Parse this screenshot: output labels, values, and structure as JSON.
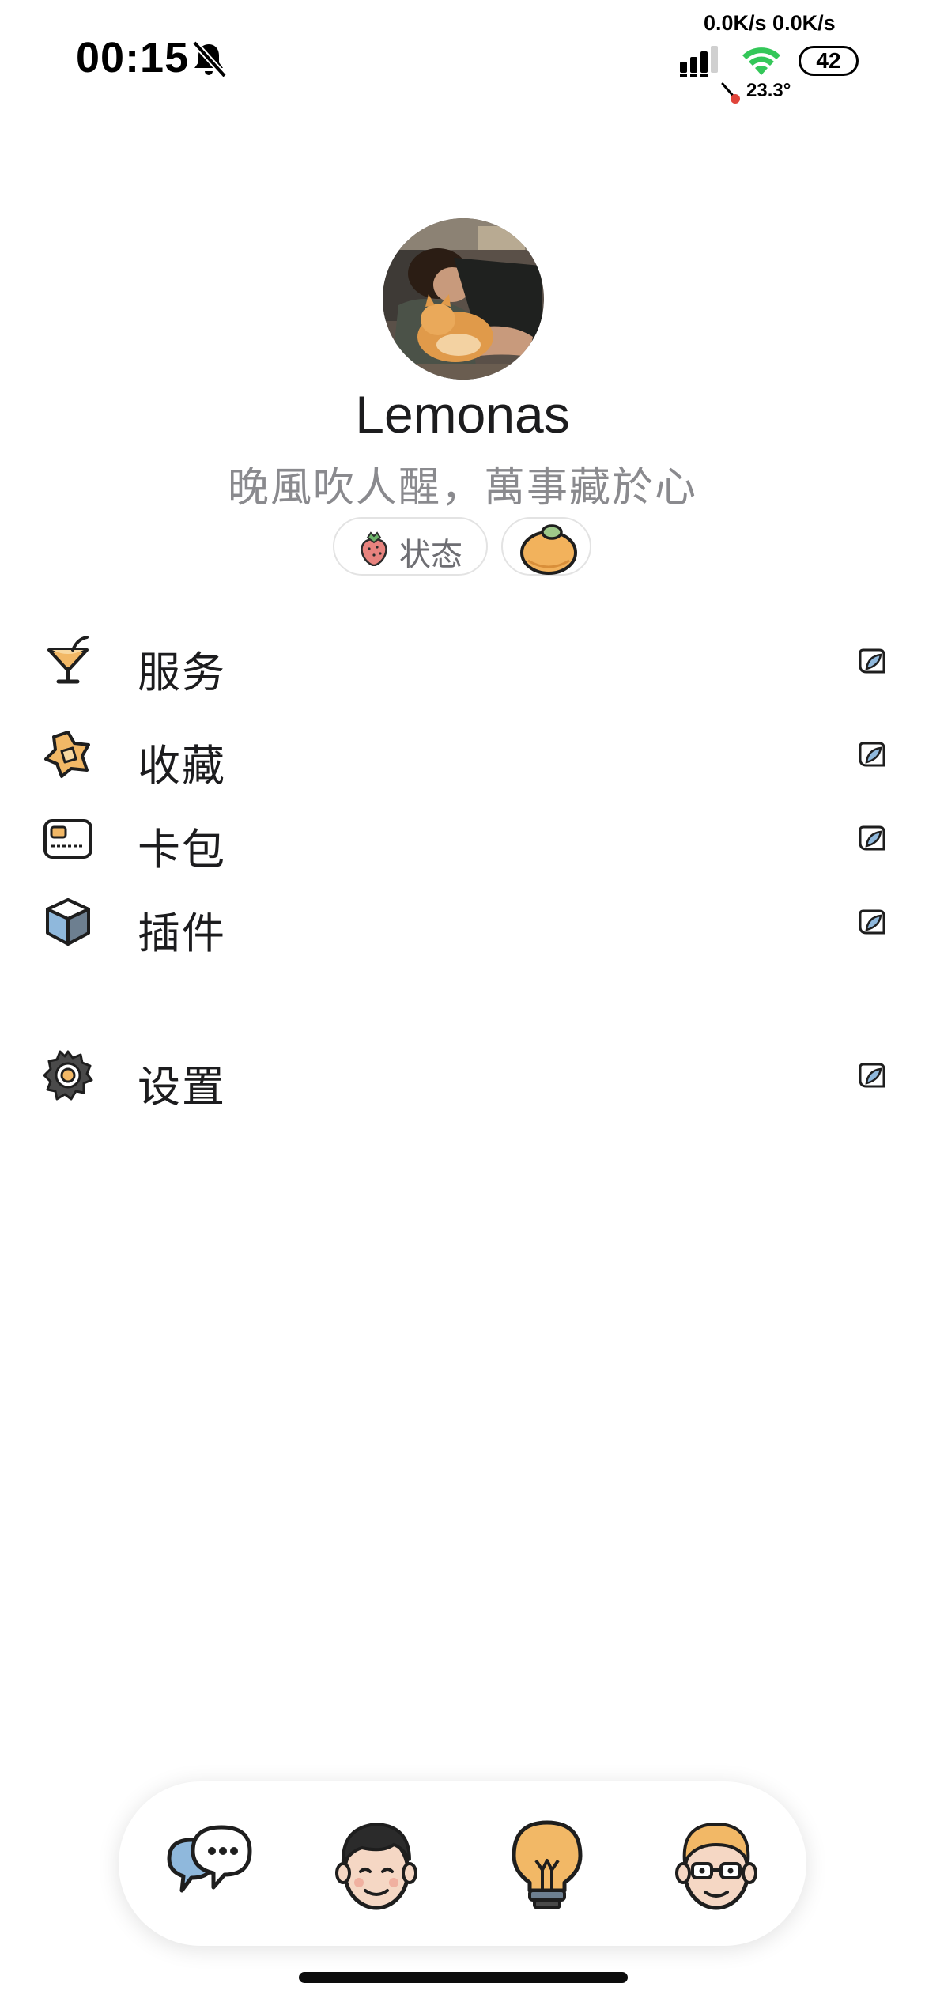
{
  "status_bar": {
    "time": "00:15",
    "net_speed": "0.0K/s 0.0K/s",
    "battery": "42",
    "temperature": "23.3°",
    "icons": [
      "bell-slash-icon",
      "signal-icon",
      "wifi-icon",
      "thermometer-icon"
    ]
  },
  "profile": {
    "name": "Lemonas",
    "bio": "晚風吹人醒，萬事藏於心",
    "status_chip_label": "状态",
    "status_chip_icon": "strawberry-icon",
    "mood_chip_icon": "orange-icon"
  },
  "menu": {
    "items": [
      {
        "label": "服务",
        "icon": "cocktail-icon"
      },
      {
        "label": "收藏",
        "icon": "star-cube-icon"
      },
      {
        "label": "卡包",
        "icon": "card-icon"
      },
      {
        "label": "插件",
        "icon": "cube-icon"
      },
      {
        "label": "设置",
        "icon": "gear-icon"
      }
    ],
    "arrow_icon": "leaf-arrow-icon"
  },
  "tab_bar": {
    "tabs": [
      {
        "name": "chat",
        "icon": "chat-bubbles-icon"
      },
      {
        "name": "contacts",
        "icon": "man-face-icon"
      },
      {
        "name": "discover",
        "icon": "lightbulb-icon"
      },
      {
        "name": "me",
        "icon": "glasses-face-icon"
      }
    ]
  },
  "colors": {
    "background": "#ffffff",
    "text_primary": "#1c1c1e",
    "text_secondary": "#8a8a8e",
    "accent_orange": "#f2b866",
    "accent_blue": "#8fb8dc",
    "wifi_green": "#34c759"
  }
}
